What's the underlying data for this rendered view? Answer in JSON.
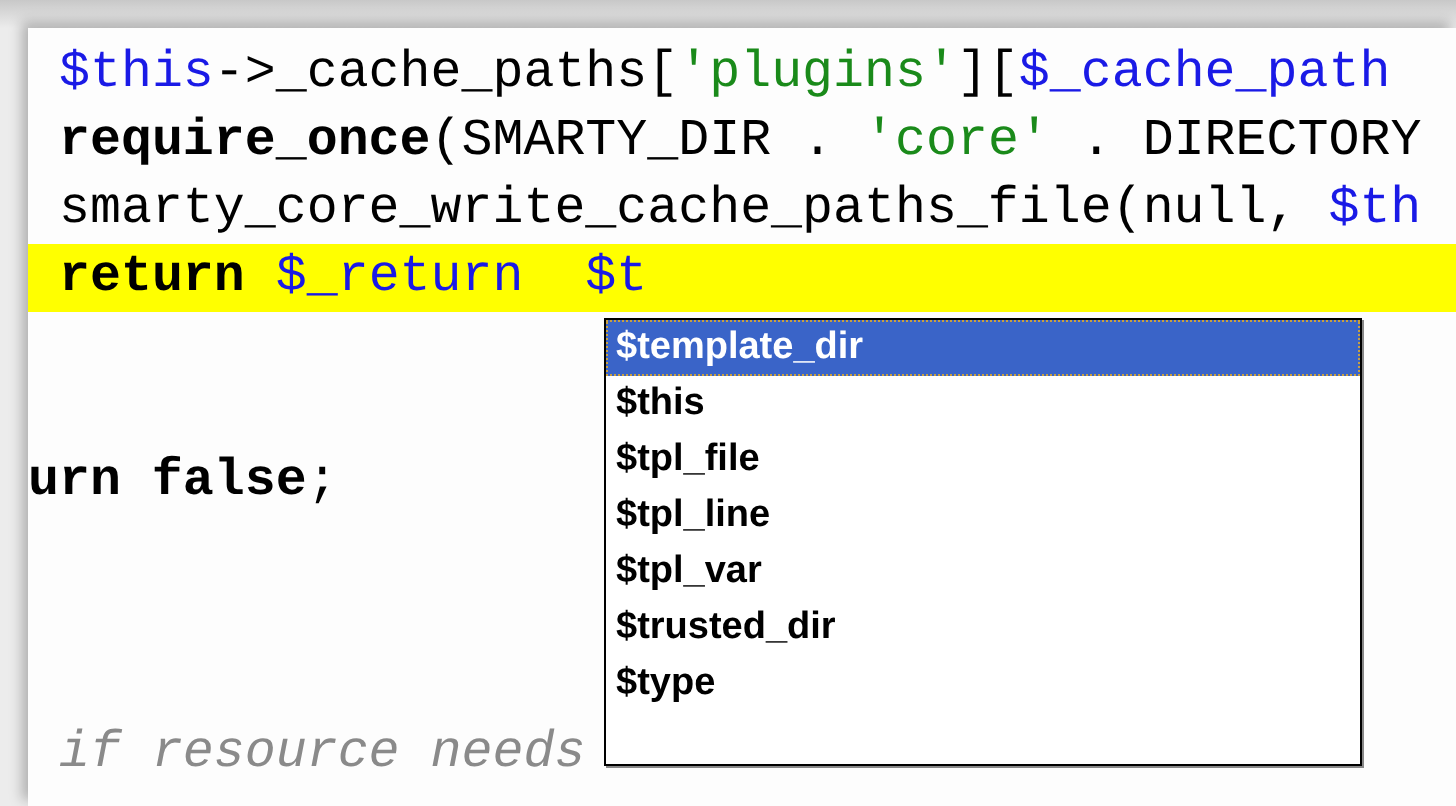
{
  "editor": {
    "lines": [
      {
        "kind": "code",
        "indented": true,
        "highlighted": false,
        "tokens": [
          {
            "kind": "variable",
            "text": "$this"
          },
          {
            "kind": "plain",
            "text": "->_cache_paths["
          },
          {
            "kind": "string",
            "text": "'plugins'"
          },
          {
            "kind": "plain",
            "text": "]["
          },
          {
            "kind": "variable",
            "text": "$_cache_path"
          }
        ]
      },
      {
        "kind": "code",
        "indented": true,
        "highlighted": false,
        "tokens": [
          {
            "kind": "keyword",
            "text": "require_once"
          },
          {
            "kind": "plain",
            "text": "(SMARTY_DIR . "
          },
          {
            "kind": "string",
            "text": "'core'"
          },
          {
            "kind": "plain",
            "text": " . DIRECTORY"
          }
        ]
      },
      {
        "kind": "code",
        "indented": true,
        "highlighted": false,
        "tokens": [
          {
            "kind": "plain",
            "text": "smarty_core_write_cache_paths_file(null, "
          },
          {
            "kind": "variable",
            "text": "$th"
          }
        ]
      },
      {
        "kind": "code",
        "indented": true,
        "highlighted": true,
        "tokens": [
          {
            "kind": "keyword",
            "text": "return "
          },
          {
            "kind": "variable",
            "text": "$_return  $t"
          }
        ]
      },
      {
        "kind": "blank"
      },
      {
        "kind": "blank"
      },
      {
        "kind": "code",
        "indented": false,
        "highlighted": false,
        "tokens": [
          {
            "kind": "keyword",
            "text": "urn false"
          },
          {
            "kind": "plain",
            "text": ";"
          }
        ]
      },
      {
        "kind": "blank"
      },
      {
        "kind": "blank"
      },
      {
        "kind": "blank"
      },
      {
        "kind": "code",
        "indented": true,
        "highlighted": false,
        "tokens": [
          {
            "kind": "comment",
            "text": "if resource needs"
          }
        ]
      }
    ]
  },
  "autocomplete": {
    "items": [
      {
        "label": "$template_dir",
        "selected": true
      },
      {
        "label": "$this",
        "selected": false
      },
      {
        "label": "$tpl_file",
        "selected": false
      },
      {
        "label": "$tpl_line",
        "selected": false
      },
      {
        "label": "$tpl_var",
        "selected": false
      },
      {
        "label": "$trusted_dir",
        "selected": false
      },
      {
        "label": "$type",
        "selected": false
      }
    ]
  }
}
